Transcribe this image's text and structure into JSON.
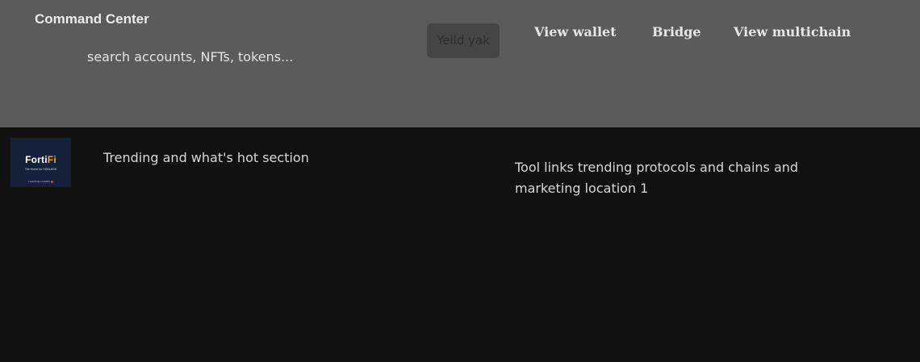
{
  "header": {
    "title": "Command Center",
    "search": {
      "placeholder": "search accounts, NFTs, tokens..."
    },
    "yield_button_label": "Yeild yak",
    "nav": [
      {
        "label": "View wallet"
      },
      {
        "label": "Bridge"
      },
      {
        "label": "View multichain"
      }
    ],
    "colors": {
      "header_bg": "#5b5b5b",
      "page_bg": "#111111"
    }
  },
  "sponsor": {
    "name_main": "Forti",
    "name_accent": "Fi",
    "tagline": "The Home for HODLERS",
    "footer": "Launching on AVAX"
  },
  "main": {
    "trending_text": "Trending and what's hot section",
    "tools_text": "Tool links trending protocols and chains and marketing location 1"
  }
}
